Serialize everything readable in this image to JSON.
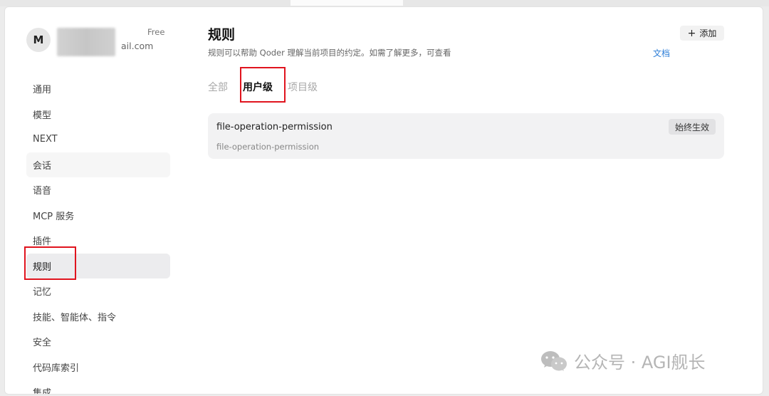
{
  "user": {
    "avatar_initial": "M",
    "plan": "Free",
    "email_partial": "ail.com"
  },
  "sidebar": {
    "items": [
      {
        "label": "通用"
      },
      {
        "label": "模型"
      },
      {
        "label": "NEXT"
      },
      {
        "label": "会话"
      },
      {
        "label": "语音"
      },
      {
        "label": "MCP 服务"
      },
      {
        "label": "插件"
      },
      {
        "label": "规则"
      },
      {
        "label": "记忆"
      },
      {
        "label": "技能、智能体、指令"
      },
      {
        "label": "安全"
      },
      {
        "label": "代码库索引"
      },
      {
        "label": "集成"
      }
    ],
    "active_label": "规则"
  },
  "main": {
    "title": "规则",
    "description": "规则可以帮助 Qoder 理解当前项目的约定。如需了解更多，可查看",
    "doc_link": "文档",
    "add_button": "添加",
    "tabs": [
      {
        "label": "全部"
      },
      {
        "label": "用户级"
      },
      {
        "label": "项目级"
      }
    ],
    "active_tab": "用户级",
    "rules": [
      {
        "name": "file-operation-permission",
        "description": "file-operation-permission",
        "badge": "始终生效"
      }
    ]
  },
  "watermark": "公众号 · AGI舰长",
  "colors": {
    "highlight_box": "#e0141e",
    "link": "#2f7fd8",
    "active_nav_bg": "#ececee"
  }
}
